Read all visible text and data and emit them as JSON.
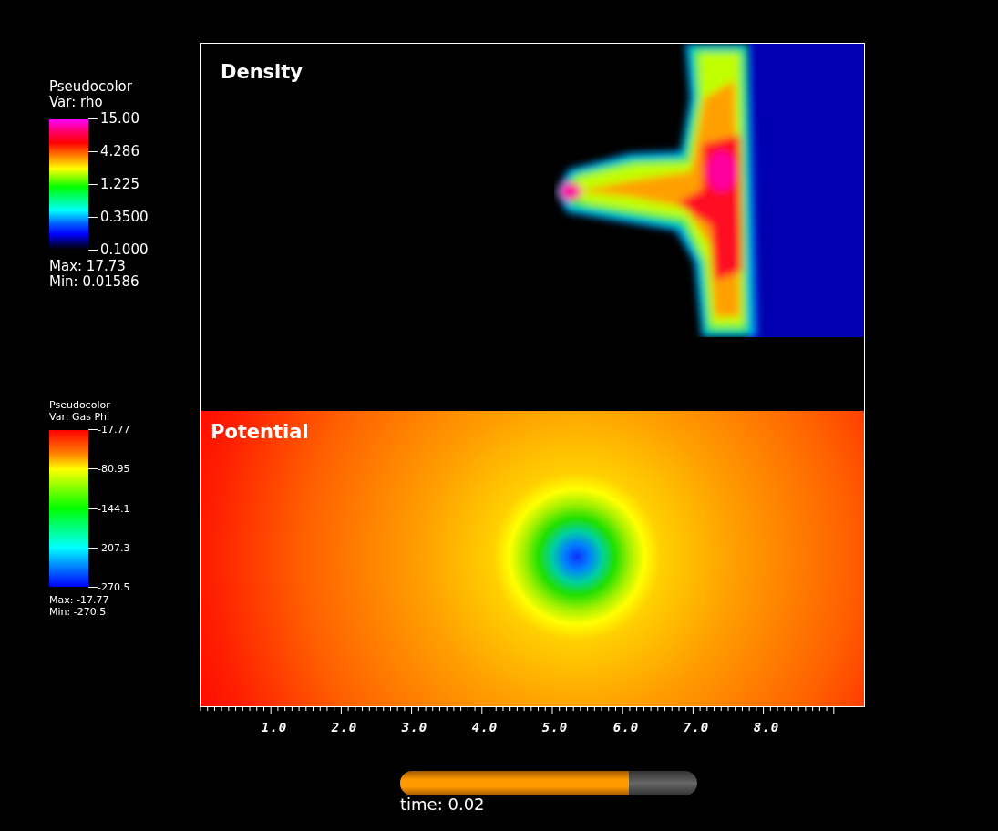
{
  "legends": [
    {
      "kind": "density",
      "plot_type": "Pseudocolor",
      "variable": "Var: rho",
      "tick_labels": [
        "15.00",
        "4.286",
        "1.225",
        "0.3500",
        "0.1000"
      ],
      "max": "Max:  17.73",
      "min": "Min:  0.01586"
    },
    {
      "kind": "potential",
      "plot_type": "Pseudocolor",
      "variable": "Var: Gas Phi",
      "tick_labels": [
        "-17.77",
        "-80.95",
        "-144.1",
        "-207.3",
        "-270.5"
      ],
      "max": "Max: -17.77",
      "min": "Min: -270.5"
    }
  ],
  "panels": [
    {
      "kind": "density",
      "title": "Density"
    },
    {
      "kind": "potential",
      "title": "Potential"
    }
  ],
  "x_axis": {
    "tick_labels": [
      "1.0",
      "2.0",
      "3.0",
      "4.0",
      "5.0",
      "6.0",
      "7.0",
      "8.0"
    ]
  },
  "time_slider": {
    "level": 0.77,
    "label": "time: 0.02"
  }
}
